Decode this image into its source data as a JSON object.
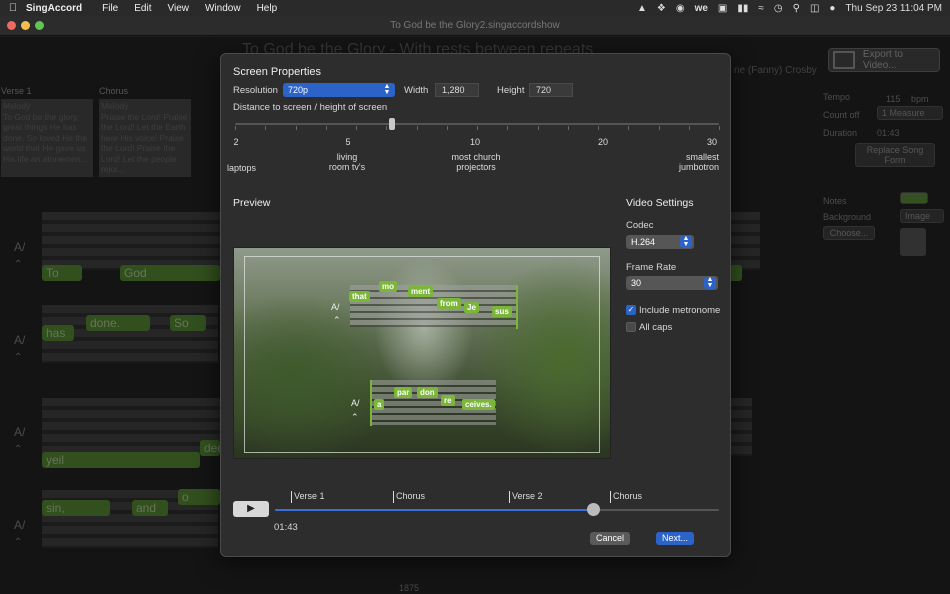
{
  "menubar": {
    "app_name": "SingAccord",
    "menus": [
      "File",
      "Edit",
      "View",
      "Window",
      "Help"
    ],
    "clock": "Thu Sep 23  11:04 PM"
  },
  "window": {
    "title": "To God be the Glory2.singaccordshow",
    "song_title": "To God be the Glory - With rests between repeats",
    "author": "ne (Fanny) Crosby"
  },
  "right_panel": {
    "export_label": "Export to Video...",
    "tempo_label": "Tempo",
    "tempo_value": "115",
    "tempo_unit": "bpm",
    "countoff_label": "Count off",
    "countoff_value": "1 Measure",
    "duration_label": "Duration",
    "duration_value": "01:43",
    "replace_label": "Replace Song Form",
    "notes_label": "Notes",
    "background_label": "Background",
    "background_value": "Image",
    "choose_label": "Choose..."
  },
  "sections": [
    {
      "header": "Verse 1",
      "part": "Melody",
      "text": "To God be the glory, great things He has done. So loved He the world that He gave us His life an atonemen..."
    },
    {
      "header": "Chorus",
      "part": "Melody",
      "text": "Praise the Lord! Praise the Lord! Let the Earth hear His voice! Praise the Lord! Praise the Lord! Let the people rejoi..."
    }
  ],
  "background_lyrics": {
    "row1": [
      "To",
      "God"
    ],
    "row2": [
      "has",
      "done.",
      "So"
    ],
    "row3": [
      "yeil",
      "dec"
    ],
    "row4": [
      "sin,",
      "and",
      "o"
    ],
    "staff_mark": "A/",
    "measure_number": "1875"
  },
  "dialog": {
    "screen_properties_title": "Screen Properties",
    "resolution_label": "Resolution",
    "resolution_value": "720p",
    "width_label": "Width",
    "width_value": "1,280",
    "height_label": "Height",
    "height_value": "720",
    "distance_label": "Distance to screen / height of screen",
    "distance_value": 6.5,
    "slider_ticks": [
      "2",
      "5",
      "10",
      "20",
      "30"
    ],
    "slider_captions": [
      {
        "line1": "laptops",
        "line2": ""
      },
      {
        "line1": "living",
        "line2": "room tv's"
      },
      {
        "line1": "most church",
        "line2": "projectors"
      },
      {
        "line1": "smallest",
        "line2": "jumbotron"
      }
    ],
    "preview_label": "Preview",
    "video_settings_title": "Video Settings",
    "codec_label": "Codec",
    "codec_value": "H.264",
    "frame_rate_label": "Frame Rate",
    "frame_rate_value": "30",
    "include_metronome_label": "Include metronome",
    "include_metronome_checked": true,
    "all_caps_label": "All caps",
    "all_caps_checked": false,
    "preview_lines": {
      "mark": "A/",
      "line1": [
        "that",
        "mo",
        "ment",
        "from",
        "Je",
        "sus"
      ],
      "line2": [
        "a",
        "par",
        "don",
        "re",
        "ceives."
      ]
    },
    "timeline_markers": [
      "Verse 1",
      "Chorus",
      "Verse 2",
      "Chorus"
    ],
    "playhead_fraction": 0.716,
    "time": "01:43",
    "cancel_label": "Cancel",
    "next_label": "Next..."
  },
  "colors": {
    "accent": "#2c63c9",
    "lyric_green": "#7bb53a",
    "timeline_blue": "#3a6fd8"
  }
}
